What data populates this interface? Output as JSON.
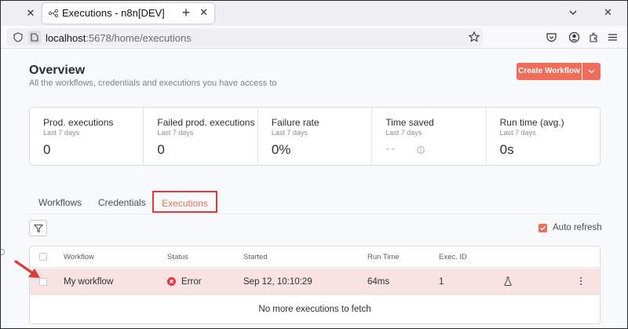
{
  "browser": {
    "tab_title": "Executions - n8n[DEV]",
    "url_host": "localhost",
    "url_path": ":5678/home/executions"
  },
  "overview": {
    "title": "Overview",
    "subtitle": "All the workflows, credentials and executions you have access to",
    "create_button": "Create Workflow"
  },
  "stats": [
    {
      "label": "Prod. executions",
      "period": "Last 7 days",
      "value": "0"
    },
    {
      "label": "Failed prod. executions",
      "period": "Last 7 days",
      "value": "0"
    },
    {
      "label": "Failure rate",
      "period": "Last 7 days",
      "value": "0%"
    },
    {
      "label": "Time saved",
      "period": "Last 7 days",
      "value": "--"
    },
    {
      "label": "Run time (avg.)",
      "period": "Last 7 days",
      "value": "0s"
    }
  ],
  "tabs": {
    "workflows": "Workflows",
    "credentials": "Credentials",
    "executions": "Executions"
  },
  "auto_refresh": {
    "label": "Auto refresh",
    "checked": true
  },
  "table": {
    "headers": {
      "workflow": "Workflow",
      "status": "Status",
      "started": "Started",
      "run_time": "Run Time",
      "exec_id": "Exec. ID"
    },
    "rows": [
      {
        "workflow": "My workflow",
        "status": "Error",
        "started": "Sep 12, 10:10:29",
        "run_time": "64ms",
        "exec_id": "1"
      }
    ],
    "footer": "No more executions to fetch"
  },
  "colors": {
    "accent": "#ef6d59",
    "error": "#e03a4a",
    "highlight_box": "#e03a3a",
    "row_error_bg": "#f9e3e2"
  },
  "icons": [
    "close-icon",
    "n8n-tab-icon",
    "plus-icon",
    "chevron-down-icon",
    "minimize-icon",
    "shield-icon",
    "page-icon",
    "star-icon",
    "pocket-icon",
    "account-icon",
    "extensions-icon",
    "menu-icon",
    "info-icon",
    "filter-icon",
    "check-icon",
    "error-icon",
    "flask-icon",
    "dots-icon",
    "arrow-icon"
  ]
}
